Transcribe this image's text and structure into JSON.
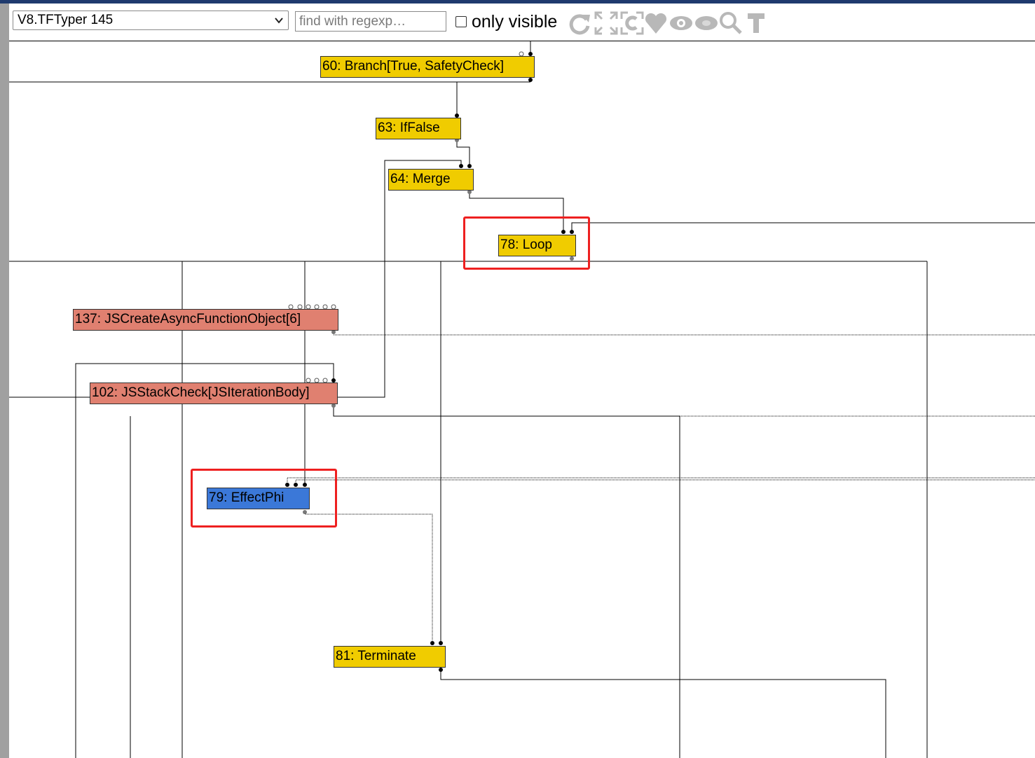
{
  "toolbar": {
    "phase_select": "V8.TFTyper 145",
    "search_placeholder": "find with regexp…",
    "only_visible_label": "only visible",
    "icons": [
      "relayout-icon",
      "show-all-icon",
      "toggle-hide-dead-icon",
      "show-control-icon",
      "hide-unselected-icon",
      "hide-selected-icon",
      "zoom-selection-icon",
      "toggle-types-icon"
    ]
  },
  "nodes": [
    {
      "id": "n60",
      "label": "60: Branch[True, SafetyCheck]",
      "color": "#f0cc00"
    },
    {
      "id": "n63",
      "label": "63: IfFalse",
      "color": "#f0cc00"
    },
    {
      "id": "n64",
      "label": "64: Merge",
      "color": "#f0cc00"
    },
    {
      "id": "n78",
      "label": "78: Loop",
      "color": "#f0cc00"
    },
    {
      "id": "n137",
      "label": "137: JSCreateAsyncFunctionObject[6]",
      "color": "#e08070"
    },
    {
      "id": "n102",
      "label": "102: JSStackCheck[JSIterationBody]",
      "color": "#e08070"
    },
    {
      "id": "n79",
      "label": "79: EffectPhi",
      "color": "#3b78d8"
    },
    {
      "id": "n81",
      "label": "81: Terminate",
      "color": "#f0cc00"
    }
  ],
  "colors": {
    "control_node": "#f0cc00",
    "js_node": "#e08070",
    "phi_node": "#3b78d8",
    "highlight": "#ee2020"
  }
}
